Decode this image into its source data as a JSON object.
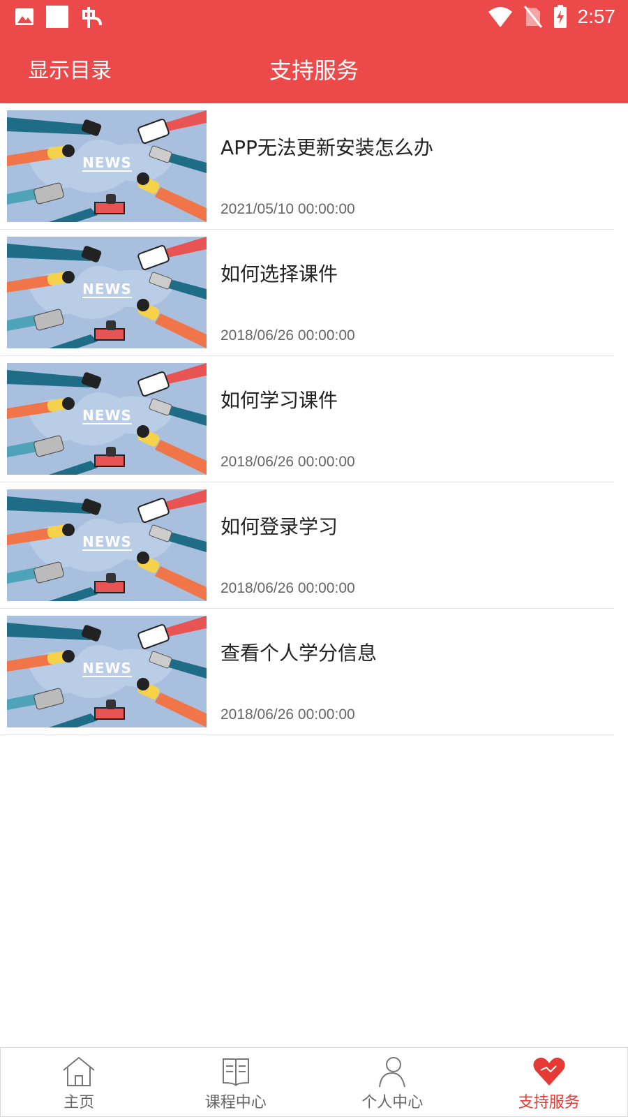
{
  "status_bar": {
    "time": "2:57",
    "icons": [
      "image-icon",
      "square-icon",
      "bug-icon",
      "wifi-icon",
      "no-sim-icon",
      "battery-charging-icon"
    ]
  },
  "app_bar": {
    "catalog_label": "显示目录",
    "title": "支持服务"
  },
  "list": {
    "items": [
      {
        "title": "APP无法更新安装怎么办",
        "date": "2021/05/10  00:00:00",
        "thumb_text": "NEWS"
      },
      {
        "title": "如何选择课件",
        "date": "2018/06/26  00:00:00",
        "thumb_text": "NEWS"
      },
      {
        "title": "如何学习课件",
        "date": "2018/06/26  00:00:00",
        "thumb_text": "NEWS"
      },
      {
        "title": "如何登录学习",
        "date": "2018/06/26  00:00:00",
        "thumb_text": "NEWS"
      },
      {
        "title": "查看个人学分信息",
        "date": "2018/06/26  00:00:00",
        "thumb_text": "NEWS"
      }
    ]
  },
  "tab_bar": {
    "tabs": [
      {
        "label": "主页",
        "icon": "home-icon",
        "active": false
      },
      {
        "label": "课程中心",
        "icon": "book-icon",
        "active": false
      },
      {
        "label": "个人中心",
        "icon": "person-icon",
        "active": false
      },
      {
        "label": "支持服务",
        "icon": "heart-icon",
        "active": true
      }
    ]
  },
  "colors": {
    "brand": "#ec4a4a",
    "active_tab": "#e53935",
    "thumb_bg": "#a8c0de"
  }
}
